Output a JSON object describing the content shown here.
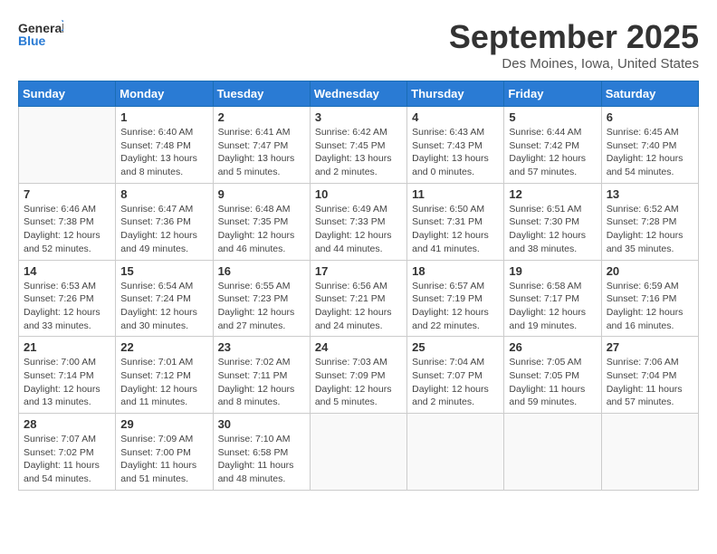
{
  "header": {
    "logo_general": "General",
    "logo_blue": "Blue",
    "month_title": "September 2025",
    "location": "Des Moines, Iowa, United States"
  },
  "weekdays": [
    "Sunday",
    "Monday",
    "Tuesday",
    "Wednesday",
    "Thursday",
    "Friday",
    "Saturday"
  ],
  "weeks": [
    [
      {
        "day": "",
        "info": ""
      },
      {
        "day": "1",
        "info": "Sunrise: 6:40 AM\nSunset: 7:48 PM\nDaylight: 13 hours\nand 8 minutes."
      },
      {
        "day": "2",
        "info": "Sunrise: 6:41 AM\nSunset: 7:47 PM\nDaylight: 13 hours\nand 5 minutes."
      },
      {
        "day": "3",
        "info": "Sunrise: 6:42 AM\nSunset: 7:45 PM\nDaylight: 13 hours\nand 2 minutes."
      },
      {
        "day": "4",
        "info": "Sunrise: 6:43 AM\nSunset: 7:43 PM\nDaylight: 13 hours\nand 0 minutes."
      },
      {
        "day": "5",
        "info": "Sunrise: 6:44 AM\nSunset: 7:42 PM\nDaylight: 12 hours\nand 57 minutes."
      },
      {
        "day": "6",
        "info": "Sunrise: 6:45 AM\nSunset: 7:40 PM\nDaylight: 12 hours\nand 54 minutes."
      }
    ],
    [
      {
        "day": "7",
        "info": "Sunrise: 6:46 AM\nSunset: 7:38 PM\nDaylight: 12 hours\nand 52 minutes."
      },
      {
        "day": "8",
        "info": "Sunrise: 6:47 AM\nSunset: 7:36 PM\nDaylight: 12 hours\nand 49 minutes."
      },
      {
        "day": "9",
        "info": "Sunrise: 6:48 AM\nSunset: 7:35 PM\nDaylight: 12 hours\nand 46 minutes."
      },
      {
        "day": "10",
        "info": "Sunrise: 6:49 AM\nSunset: 7:33 PM\nDaylight: 12 hours\nand 44 minutes."
      },
      {
        "day": "11",
        "info": "Sunrise: 6:50 AM\nSunset: 7:31 PM\nDaylight: 12 hours\nand 41 minutes."
      },
      {
        "day": "12",
        "info": "Sunrise: 6:51 AM\nSunset: 7:30 PM\nDaylight: 12 hours\nand 38 minutes."
      },
      {
        "day": "13",
        "info": "Sunrise: 6:52 AM\nSunset: 7:28 PM\nDaylight: 12 hours\nand 35 minutes."
      }
    ],
    [
      {
        "day": "14",
        "info": "Sunrise: 6:53 AM\nSunset: 7:26 PM\nDaylight: 12 hours\nand 33 minutes."
      },
      {
        "day": "15",
        "info": "Sunrise: 6:54 AM\nSunset: 7:24 PM\nDaylight: 12 hours\nand 30 minutes."
      },
      {
        "day": "16",
        "info": "Sunrise: 6:55 AM\nSunset: 7:23 PM\nDaylight: 12 hours\nand 27 minutes."
      },
      {
        "day": "17",
        "info": "Sunrise: 6:56 AM\nSunset: 7:21 PM\nDaylight: 12 hours\nand 24 minutes."
      },
      {
        "day": "18",
        "info": "Sunrise: 6:57 AM\nSunset: 7:19 PM\nDaylight: 12 hours\nand 22 minutes."
      },
      {
        "day": "19",
        "info": "Sunrise: 6:58 AM\nSunset: 7:17 PM\nDaylight: 12 hours\nand 19 minutes."
      },
      {
        "day": "20",
        "info": "Sunrise: 6:59 AM\nSunset: 7:16 PM\nDaylight: 12 hours\nand 16 minutes."
      }
    ],
    [
      {
        "day": "21",
        "info": "Sunrise: 7:00 AM\nSunset: 7:14 PM\nDaylight: 12 hours\nand 13 minutes."
      },
      {
        "day": "22",
        "info": "Sunrise: 7:01 AM\nSunset: 7:12 PM\nDaylight: 12 hours\nand 11 minutes."
      },
      {
        "day": "23",
        "info": "Sunrise: 7:02 AM\nSunset: 7:11 PM\nDaylight: 12 hours\nand 8 minutes."
      },
      {
        "day": "24",
        "info": "Sunrise: 7:03 AM\nSunset: 7:09 PM\nDaylight: 12 hours\nand 5 minutes."
      },
      {
        "day": "25",
        "info": "Sunrise: 7:04 AM\nSunset: 7:07 PM\nDaylight: 12 hours\nand 2 minutes."
      },
      {
        "day": "26",
        "info": "Sunrise: 7:05 AM\nSunset: 7:05 PM\nDaylight: 11 hours\nand 59 minutes."
      },
      {
        "day": "27",
        "info": "Sunrise: 7:06 AM\nSunset: 7:04 PM\nDaylight: 11 hours\nand 57 minutes."
      }
    ],
    [
      {
        "day": "28",
        "info": "Sunrise: 7:07 AM\nSunset: 7:02 PM\nDaylight: 11 hours\nand 54 minutes."
      },
      {
        "day": "29",
        "info": "Sunrise: 7:09 AM\nSunset: 7:00 PM\nDaylight: 11 hours\nand 51 minutes."
      },
      {
        "day": "30",
        "info": "Sunrise: 7:10 AM\nSunset: 6:58 PM\nDaylight: 11 hours\nand 48 minutes."
      },
      {
        "day": "",
        "info": ""
      },
      {
        "day": "",
        "info": ""
      },
      {
        "day": "",
        "info": ""
      },
      {
        "day": "",
        "info": ""
      }
    ]
  ]
}
